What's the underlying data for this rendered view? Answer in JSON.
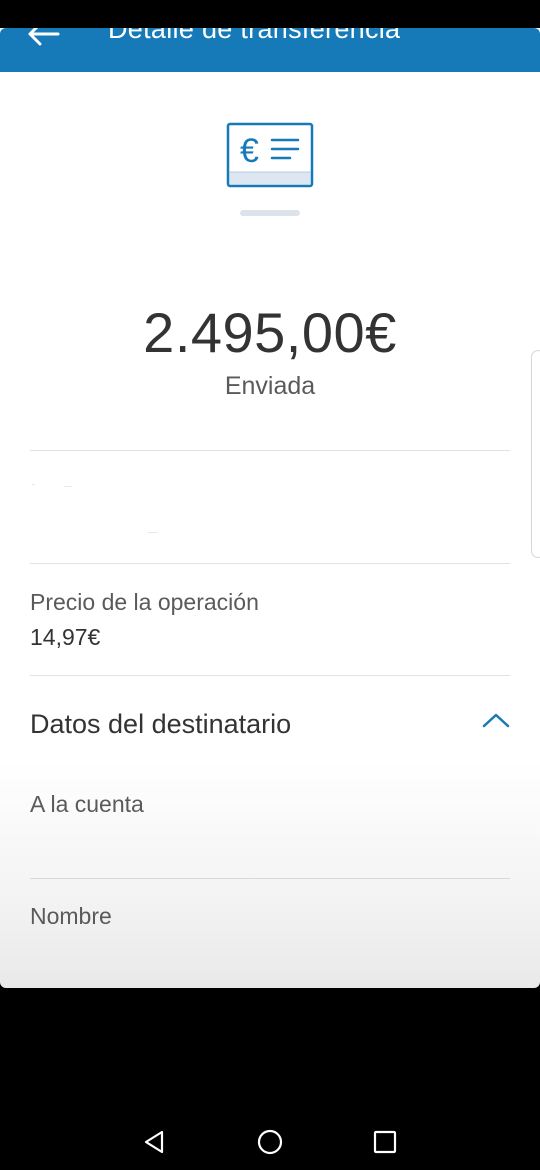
{
  "header": {
    "title": "Detalle de transferencia",
    "back_icon": "arrow-left-icon",
    "background_color": "#1679b8"
  },
  "hero": {
    "icon": "euro-document-icon",
    "accent_color": "#1679b8"
  },
  "transfer": {
    "amount": "2.495,00€",
    "status": "Enviada"
  },
  "fee": {
    "label": "Precio de la operación",
    "value": "14,97€"
  },
  "recipient": {
    "section_title": "Datos del destinatario",
    "toggle_icon": "chevron-up-icon",
    "fields": [
      {
        "label": "A la cuenta"
      },
      {
        "label": "Nombre"
      }
    ]
  },
  "system_nav": {
    "back_icon": "triangle-back-icon",
    "home_icon": "circle-home-icon",
    "recents_icon": "square-recents-icon"
  }
}
